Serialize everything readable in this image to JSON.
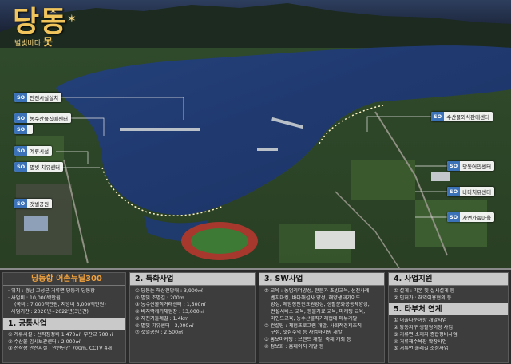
{
  "logo": {
    "title": "당동",
    "subtitle_prefix": "별빛바다",
    "subtitle_word": "못"
  },
  "map_tags": [
    {
      "num": "SO",
      "label": "안전시설설치"
    },
    {
      "num": "SO",
      "label": "농수산물직매센터"
    },
    {
      "num": "SO",
      "label": ""
    },
    {
      "num": "SO",
      "label": "계류시설"
    },
    {
      "num": "SO",
      "label": "별빛 치유센터"
    },
    {
      "num": "SO",
      "label": "갯벌공원"
    },
    {
      "num": "SO",
      "label": "수산물외식판매센터"
    },
    {
      "num": "SO",
      "label": "당동어민센터"
    },
    {
      "num": "SO",
      "label": "바다치유센터"
    },
    {
      "num": "SO",
      "label": "자연가족마을"
    }
  ],
  "panel": {
    "col1": {
      "head": "당동항 어촌뉴딜300",
      "lines": [
        "· 위치 : 경남 고성군 거류면 당동리 당동항",
        "· 사업비 : 10,000백만원",
        "(국비 : 7,000백만원, 지방비 3,000백만원)",
        "· 사업기간 : 2020년~2022년(3년간)"
      ],
      "sub_head": "1. 공통사업",
      "sub_lines": [
        "① 계류시설 : 선착장정비 1,470㎡, 부잔교 700㎡",
        "② 수산물 임시보관센터 : 2,000㎡",
        "③ 선착장 안전시설 : 안전난간 700m, CCTV 4개"
      ]
    },
    "col2": {
      "head": "2. 특화사업",
      "lines": [
        "① 당동는 해상전망대 : 3,900㎡",
        "② 별빛 조명길 : 200m",
        "③ 농수산물직거래센터 : 1,500㎡",
        "④ 바지락캐기체험장 : 13,000㎡",
        "⑤ 자전거둘레길 : 1.4km",
        "⑥ 별빛 치유센터 : 3,000㎡",
        "⑦ 갯벌공원 : 2,500㎡"
      ]
    },
    "col3": {
      "head": "3. SW사업",
      "lines": [
        "① 교육 : 농업리더양성, 전문가 초빙교육, 선진사례",
        "벤치마킹, 바다해설사 양성, 해양생태가이드",
        "양성, 체험장안전요원양성, 생활문화공동체양성,",
        "컨설서비스 교육, 동물치료 교육, 마케팅 교육,",
        "마인드교육, 농수산물직거래협대 매뉴개발",
        "② 컨설팅 : 체험프로그램 개발, 사회적경제조직",
        "구성, 맛집주역 등 사업마이핑 개발",
        "③ 홍보마케팅 : 브랜드 개발, 축제 개최 등",
        "④ 정보화 : 홈페이지 개발 등"
      ]
    },
    "col4": {
      "head": "4. 사업지원",
      "lines": [
        "① 설계 : 기본 및 실시설계 등",
        "② 인허가 : 해역이용협의 등"
      ],
      "sub_head": "5. 타부처 연계",
      "sub_lines": [
        "① 어울다운어항 개발사업",
        "② 당동지구 생활형이장 사업",
        "③ 거류면 소재지 종합정비사업",
        "④ 거류해수욕장 확장사업",
        "⑤ 거류면 둘레길 조성사업"
      ]
    }
  }
}
